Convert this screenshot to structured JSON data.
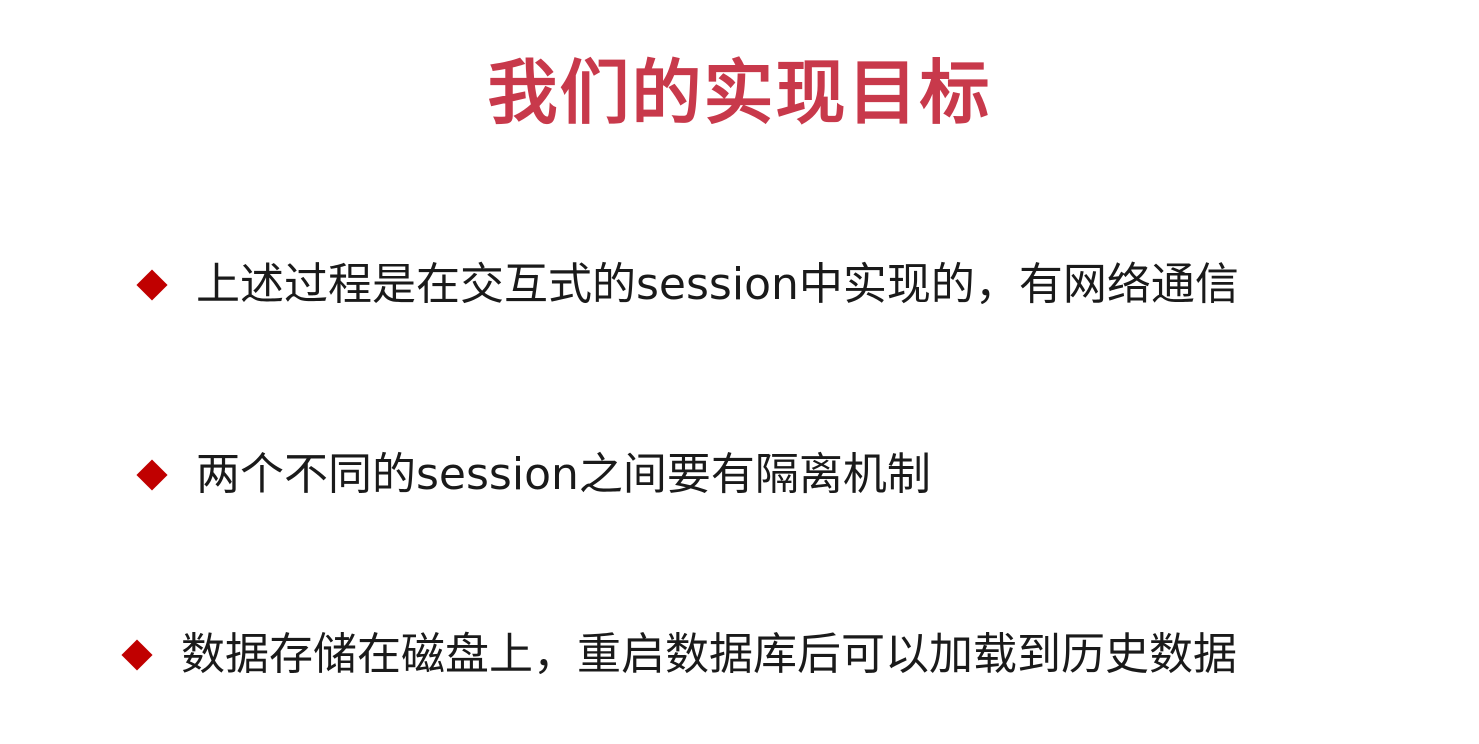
{
  "colors": {
    "title": "#c8394b",
    "bullet": "#c00000",
    "text": "#1a1a1a",
    "background": "#ffffff"
  },
  "slide": {
    "title": "我们的实现目标",
    "bullets": [
      {
        "icon": "diamond-bullet-icon",
        "text": "上述过程是在交互式的session中实现的，有网络通信"
      },
      {
        "icon": "diamond-bullet-icon",
        "text": "两个不同的session之间要有隔离机制"
      },
      {
        "icon": "diamond-bullet-icon",
        "text": "数据存储在磁盘上，重启数据库后可以加载到历史数据"
      }
    ]
  }
}
